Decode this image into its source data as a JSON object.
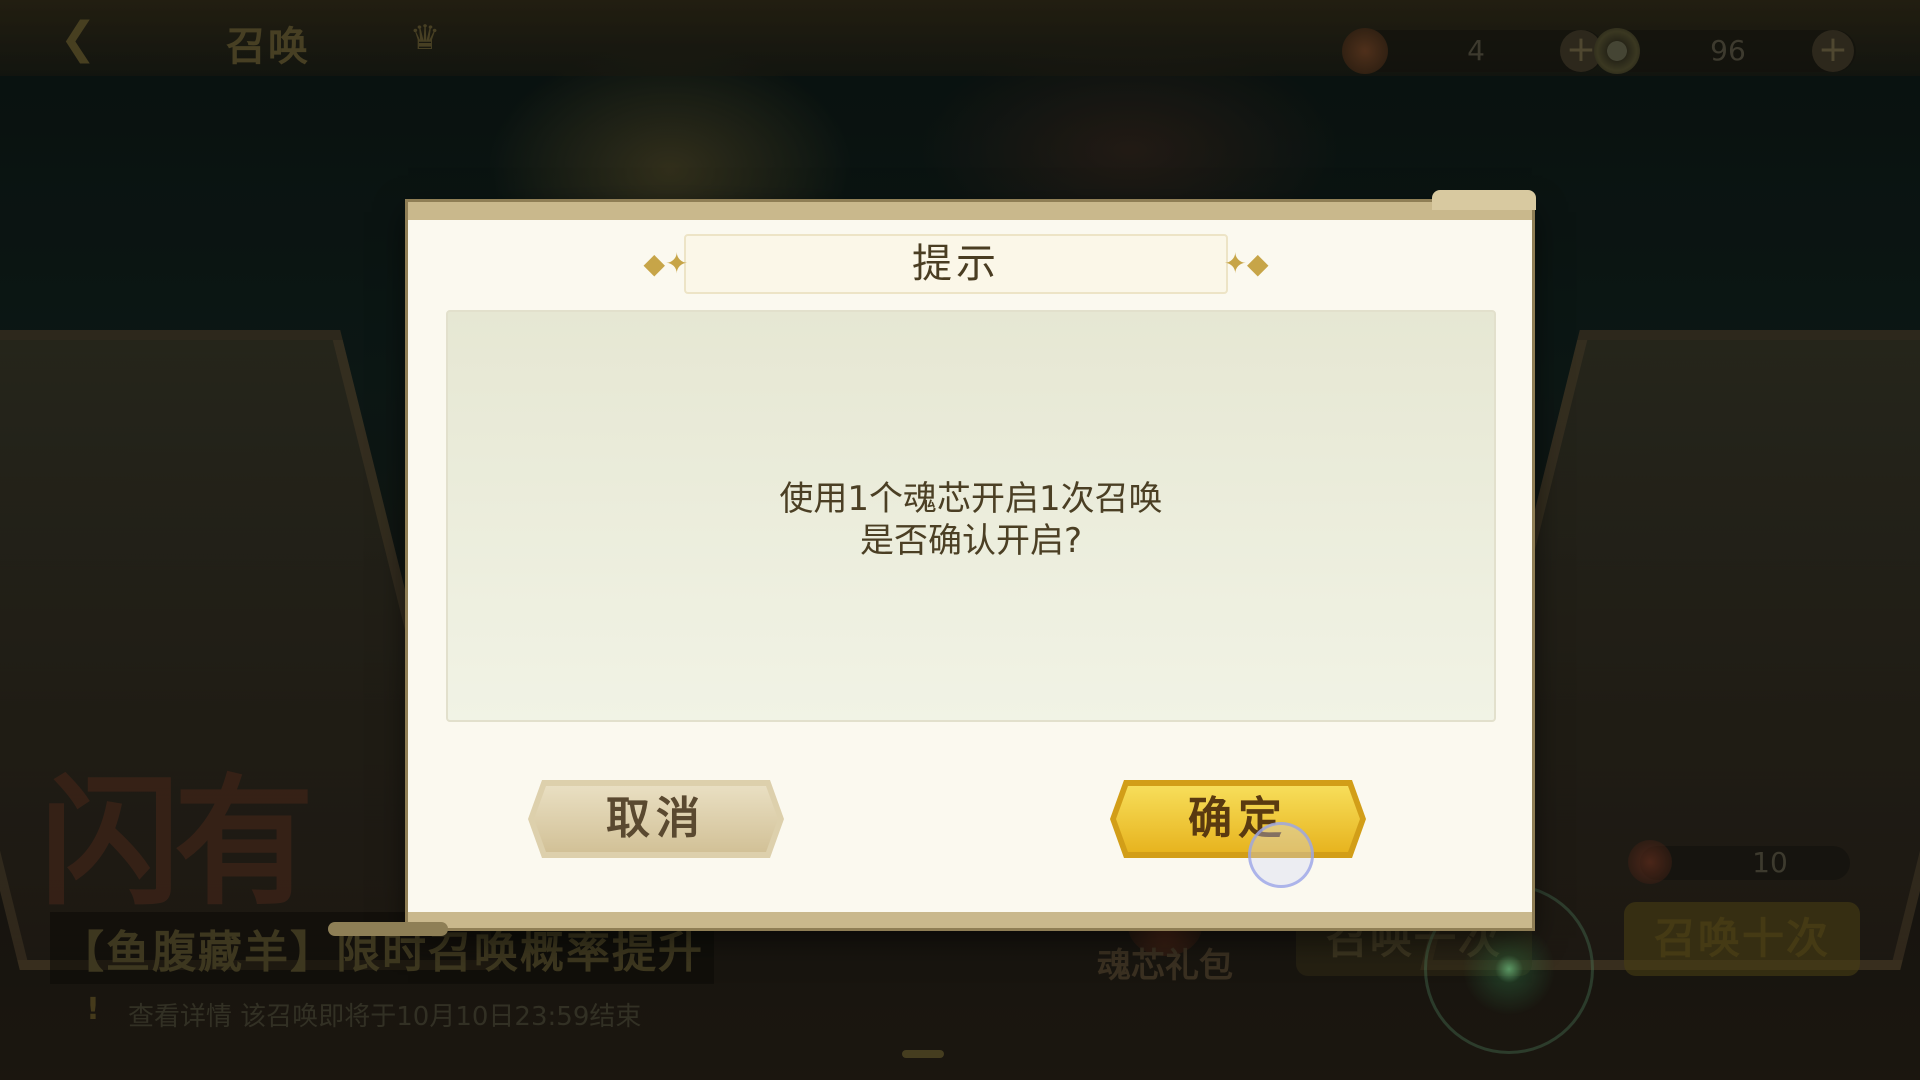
{
  "topbar": {
    "back_icon": "back-arrow-icon",
    "title": "召唤",
    "crown_icon": "crown-icon",
    "resources": [
      {
        "icon": "soul-core-icon",
        "value": "4"
      },
      {
        "icon": "coin-icon",
        "value": "96"
      }
    ]
  },
  "bottom": {
    "promo_text": "闪有",
    "banner": "【鱼腹藏羊】限时召唤概率提升",
    "notice": "查看详情  该召唤即将于10月10日23:59结束",
    "gift_label": "魂芯礼包",
    "summon_one_label": "召唤一次",
    "summon_ten_label": "召唤十次",
    "ten_count": "10"
  },
  "dialog": {
    "title": "提示",
    "message_line1": "使用1个魂芯开启1次召唤",
    "message_line2": "是否确认开启?",
    "cancel_label": "取消",
    "confirm_label": "确定"
  },
  "colors": {
    "dialog_bg": "#fbf9ef",
    "confirm_button": "#f0c82e",
    "cancel_button": "#ddd0ac",
    "text_dark": "#4b3f24"
  }
}
